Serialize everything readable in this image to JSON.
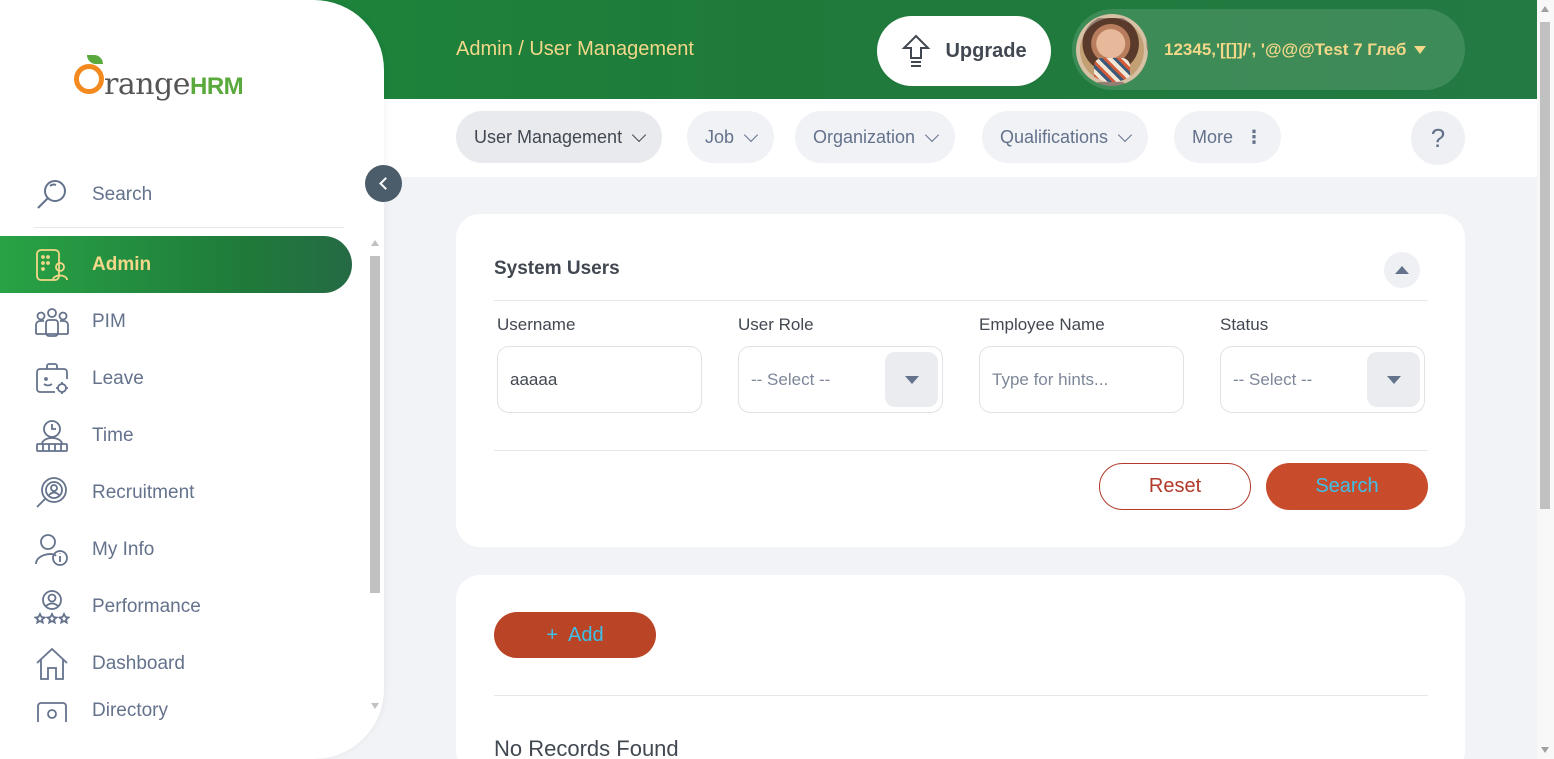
{
  "header": {
    "breadcrumb": "Admin / User Management",
    "upgrade_label": "Upgrade",
    "user_name": "12345,'[[]]/', '@@@Test 7 Глеб"
  },
  "logo": {
    "text": "range",
    "hrm": "HRM"
  },
  "sidebar": {
    "search_label": "Search",
    "items": [
      {
        "label": "Admin",
        "icon": "admin-icon",
        "active": true
      },
      {
        "label": "PIM",
        "icon": "pim-icon"
      },
      {
        "label": "Leave",
        "icon": "leave-icon"
      },
      {
        "label": "Time",
        "icon": "time-icon"
      },
      {
        "label": "Recruitment",
        "icon": "recruitment-icon"
      },
      {
        "label": "My Info",
        "icon": "my-info-icon"
      },
      {
        "label": "Performance",
        "icon": "performance-icon"
      },
      {
        "label": "Dashboard",
        "icon": "dashboard-icon"
      },
      {
        "label": "Directory",
        "icon": "directory-icon"
      }
    ]
  },
  "subnav": {
    "tabs": [
      {
        "label": "User Management"
      },
      {
        "label": "Job"
      },
      {
        "label": "Organization"
      },
      {
        "label": "Qualifications"
      },
      {
        "label": "More"
      }
    ],
    "help": "?"
  },
  "filters": {
    "title": "System Users",
    "username": {
      "label": "Username",
      "value": "aaaaa"
    },
    "user_role": {
      "label": "User Role",
      "value": "-- Select --"
    },
    "employee_name": {
      "label": "Employee Name",
      "placeholder": "Type for hints..."
    },
    "status": {
      "label": "Status",
      "value": "-- Select --"
    },
    "reset_label": "Reset",
    "search_label": "Search"
  },
  "records": {
    "add_label": "Add",
    "add_prefix": "+",
    "empty_text": "No Records Found"
  },
  "colors": {
    "header_green": "#1f7a3a",
    "accent_orange": "#c84b2c",
    "accent_yellow": "#f3d889"
  }
}
